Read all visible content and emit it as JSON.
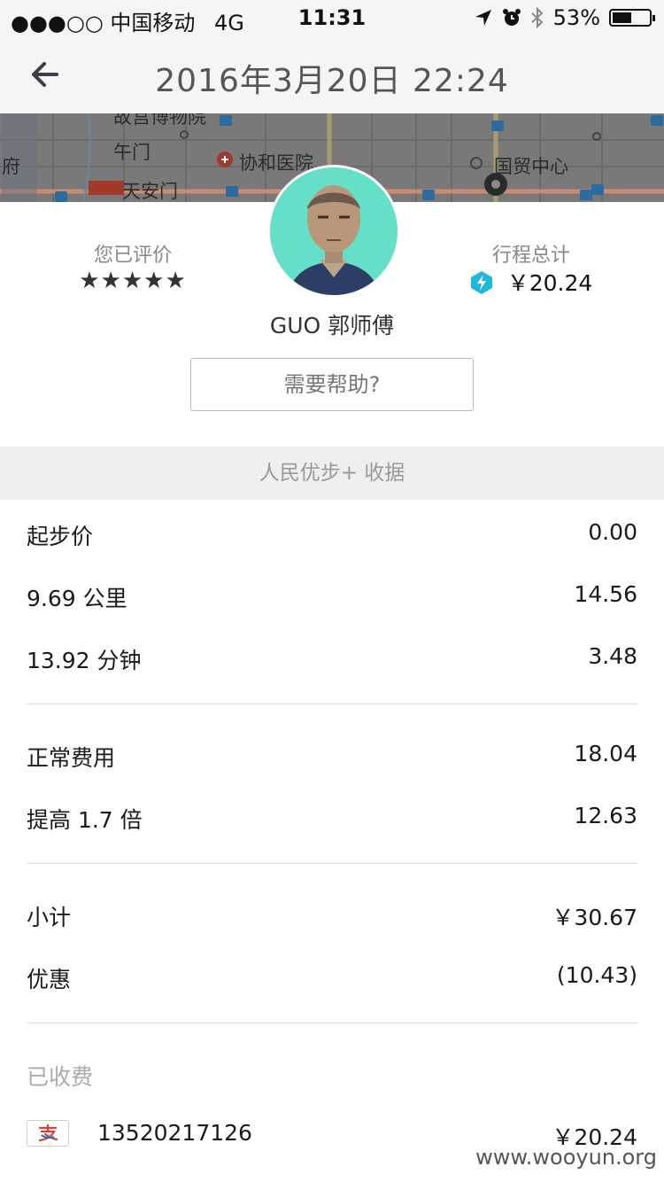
{
  "status_bar": {
    "signal": "●●●○○",
    "carrier": "中国移动",
    "network": "4G",
    "time": "11:31",
    "battery": "53%",
    "battery_level": 0.53
  },
  "header": {
    "title": "2016年3月20日 22:24"
  },
  "map": {
    "labels": {
      "museum": "故宫博物院",
      "wumen": "午门",
      "tiananmen": "天安门",
      "hospital": "协和医院",
      "guomao": "国贸中心",
      "fu": "府"
    }
  },
  "trip": {
    "rating_label": "您已评价",
    "rating_stars": "★★★★★",
    "rating_value": 5,
    "total_label": "行程总计",
    "total_amount": "￥20.24",
    "driver_name": "GUO 郭师傅",
    "help_button": "需要帮助?"
  },
  "receipt": {
    "title": "人民优步+ 收据",
    "base": {
      "label": "起步价",
      "value": "0.00"
    },
    "distance": {
      "label": "9.69 公里",
      "value": "14.56"
    },
    "time": {
      "label": "13.92 分钟",
      "value": "3.48"
    },
    "normal_fare": {
      "label": "正常费用",
      "value": "18.04"
    },
    "surge": {
      "label": "提高 1.7 倍",
      "value": "12.63"
    },
    "subtotal": {
      "label": "小计",
      "value": "￥30.67"
    },
    "discount": {
      "label": "优惠",
      "value": "(10.43)"
    },
    "charged_label": "已收费",
    "payment": {
      "account": "13520217126",
      "amount": "￥20.24"
    }
  },
  "watermark": "www.wooyun.org",
  "colors": {
    "header_bg": "#f5f5f5",
    "section_bg": "#efefef",
    "avatar_bg": "#66dfc9",
    "brand_accent": "#1fb8d8"
  }
}
